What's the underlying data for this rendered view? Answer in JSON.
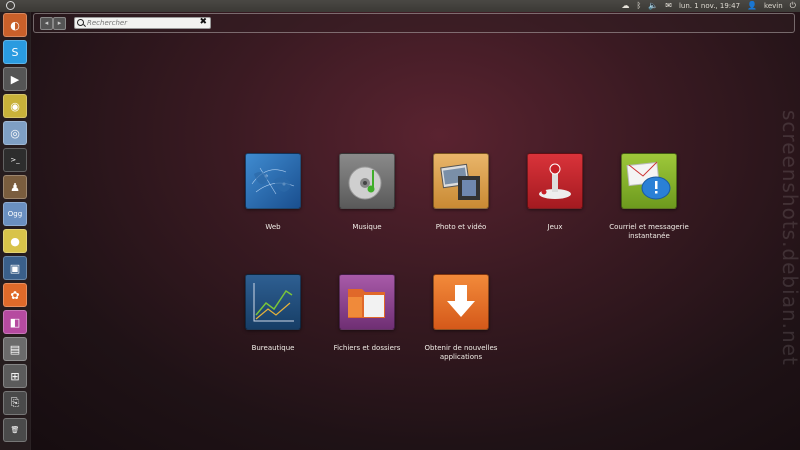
{
  "top_panel": {
    "datetime": "lun. 1 nov., 19:47",
    "user": "kevin",
    "indicators": [
      "cloud-icon",
      "bluetooth-icon",
      "volume-icon",
      "mail-icon"
    ]
  },
  "launcher": {
    "items": [
      {
        "name": "launcher-bfb",
        "glyph": "◐",
        "color": "#c9602a"
      },
      {
        "name": "launcher-skype",
        "glyph": "S",
        "color": "#2a9be0"
      },
      {
        "name": "launcher-video",
        "glyph": "▶",
        "color": "#555"
      },
      {
        "name": "launcher-webcam",
        "glyph": "◉",
        "color": "#c9b23a"
      },
      {
        "name": "launcher-chrome",
        "glyph": "◎",
        "color": "#7f9fc4"
      },
      {
        "name": "launcher-terminal",
        "glyph": ">_",
        "color": "#2d2d2d"
      },
      {
        "name": "launcher-games",
        "glyph": "♟",
        "color": "#7a5d3e"
      },
      {
        "name": "launcher-ogg",
        "glyph": "Ogg",
        "color": "#6a8fc0"
      },
      {
        "name": "launcher-disc",
        "glyph": "●",
        "color": "#d8c34a"
      },
      {
        "name": "launcher-photos",
        "glyph": "▣",
        "color": "#3a5f8a"
      },
      {
        "name": "launcher-ubuntu-one",
        "glyph": "✿",
        "color": "#e06a2a"
      },
      {
        "name": "launcher-wine",
        "glyph": "◧",
        "color": "#b64aa0"
      },
      {
        "name": "launcher-files",
        "glyph": "▤",
        "color": "#6b6b6b"
      },
      {
        "name": "launcher-workspaces",
        "glyph": "⊞",
        "color": "#5b5b5b"
      },
      {
        "name": "launcher-usb",
        "glyph": "⎘",
        "color": "#4a4a4a"
      },
      {
        "name": "launcher-trash",
        "glyph": "🗑",
        "color": "#4a4a4a"
      }
    ]
  },
  "dash": {
    "search_placeholder": "Rechercher"
  },
  "categories": [
    {
      "label": "Web"
    },
    {
      "label": "Musique"
    },
    {
      "label": "Photo et vidéo"
    },
    {
      "label": "Jeux"
    },
    {
      "label": "Courriel et messagerie instantanée"
    },
    {
      "label": "Bureautique"
    },
    {
      "label": "Fichiers et dossiers"
    },
    {
      "label": "Obtenir de nouvelles applications"
    }
  ],
  "watermark": "screenshots.debian.net"
}
